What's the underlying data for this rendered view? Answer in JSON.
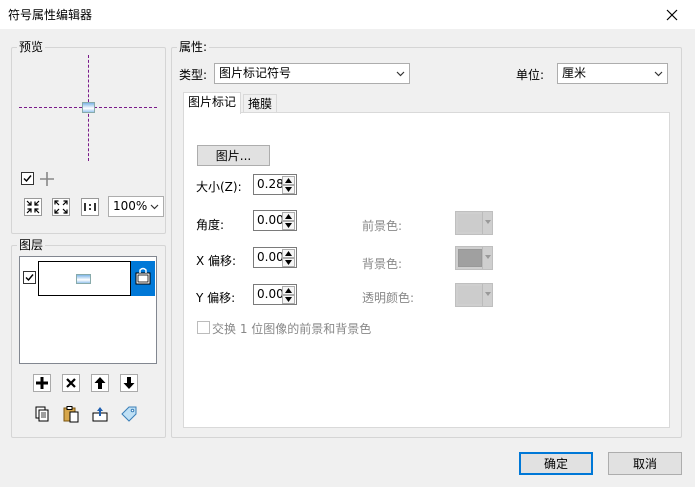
{
  "window": {
    "title": "符号属性编辑器",
    "close_icon": "close-icon"
  },
  "preview": {
    "group_label": "预览",
    "zoom_value": "100%",
    "tools": [
      "checkbox-toggle-icon",
      "add-icon",
      "zoom-in-icon",
      "zoom-out-icon",
      "actual-size-icon"
    ]
  },
  "layers": {
    "group_label": "图层",
    "actions": [
      "add-layer-icon",
      "delete-layer-icon",
      "move-up-icon",
      "move-down-icon",
      "copy-icon",
      "paste-icon",
      "export-icon",
      "tag-icon"
    ]
  },
  "properties": {
    "group_label": "属性:",
    "type_label": "类型:",
    "type_value": "图片标记符号",
    "unit_label": "单位:",
    "unit_value": "厘米",
    "tabs": [
      {
        "label": "图片标记",
        "active": true
      },
      {
        "label": "掩膜",
        "active": false
      }
    ],
    "picture_button": "图片...",
    "size_label": "大小(Z):",
    "size_value": "0.28",
    "angle_label": "角度:",
    "angle_value": "0.00",
    "x_offset_label": "X 偏移:",
    "x_offset_value": "0.00",
    "y_offset_label": "Y 偏移:",
    "y_offset_value": "0.00",
    "foreground_label": "前景色:",
    "background_label": "背景色:",
    "transparent_label": "透明颜色:",
    "swap_label": "交换 1 位图像的前景和背景色"
  },
  "footer": {
    "ok": "确定",
    "cancel": "取消"
  },
  "colors": {
    "accent": "#0078d7",
    "guide": "#7a1a8a"
  }
}
